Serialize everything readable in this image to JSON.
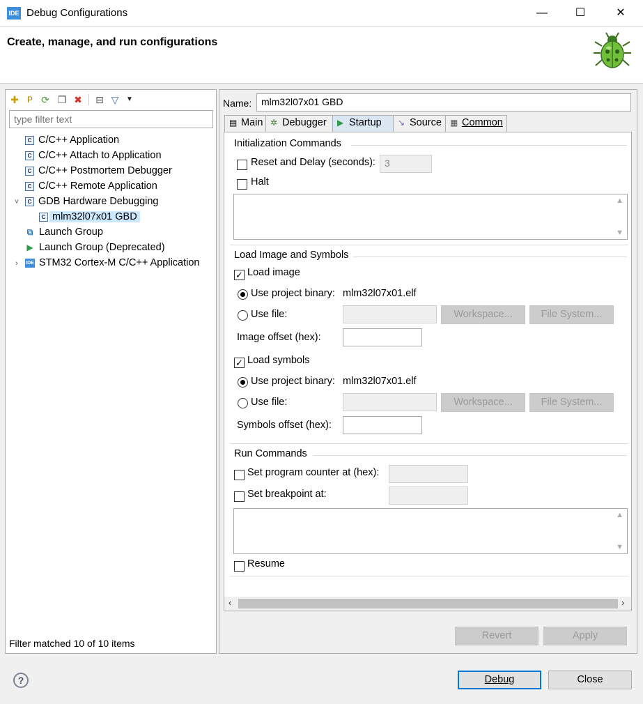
{
  "window": {
    "title": "Debug Configurations",
    "app_icon_text": "IDE",
    "minimize_glyph": "—",
    "maximize_glyph": "☐",
    "close_glyph": "✕"
  },
  "header": {
    "title": "Create, manage, and run configurations"
  },
  "left": {
    "filter_placeholder": "type filter text",
    "toolbar_icons": [
      "new-configuration-icon",
      "new-prototype-icon",
      "export-icon",
      "duplicate-icon",
      "delete-icon",
      "collapse-all-icon",
      "filter-icon",
      "chevron-down-icon"
    ],
    "tree": [
      {
        "label": "C/C++ Application",
        "icon": "c-config-icon",
        "level": 0,
        "twisty": ""
      },
      {
        "label": "C/C++ Attach to Application",
        "icon": "c-config-icon",
        "level": 0,
        "twisty": ""
      },
      {
        "label": "C/C++ Postmortem Debugger",
        "icon": "c-config-icon",
        "level": 0,
        "twisty": ""
      },
      {
        "label": "C/C++ Remote Application",
        "icon": "c-config-icon",
        "level": 0,
        "twisty": ""
      },
      {
        "label": "GDB Hardware Debugging",
        "icon": "c-config-icon",
        "level": 0,
        "twisty": "˅"
      },
      {
        "label": "mlm32l07x01 GBD",
        "icon": "c-config-icon",
        "level": 1,
        "twisty": "",
        "selected": true
      },
      {
        "label": "Launch Group",
        "icon": "launch-group-icon",
        "level": 0,
        "twisty": ""
      },
      {
        "label": "Launch Group (Deprecated)",
        "icon": "launch-deprecated-icon",
        "level": 0,
        "twisty": ""
      },
      {
        "label": "STM32 Cortex-M C/C++ Application",
        "icon": "ide-icon",
        "level": 0,
        "twisty": "›"
      }
    ],
    "status": "Filter matched 10 of 10 items"
  },
  "right": {
    "name_label": "Name:",
    "name_value": "mlm32l07x01 GBD",
    "tabs": [
      {
        "label": "Main",
        "icon": "main-tab-icon",
        "glyph": "▤"
      },
      {
        "label": "Debugger",
        "icon": "debugger-tab-icon",
        "glyph": "✲"
      },
      {
        "label": "Startup",
        "icon": "startup-tab-icon",
        "glyph": "▶"
      },
      {
        "label": "Source",
        "icon": "source-tab-icon",
        "glyph": "↘"
      },
      {
        "label": "Common",
        "icon": "common-tab-icon",
        "glyph": "▦"
      }
    ],
    "active_tab": "Startup",
    "init": {
      "title": "Initialization Commands",
      "reset_label": "Reset and Delay (seconds):",
      "reset_checked": false,
      "delay_value": "3",
      "halt_label": "Halt",
      "halt_checked": false
    },
    "load": {
      "title": "Load Image and Symbols",
      "load_image_label": "Load image",
      "load_image_checked": true,
      "use_project_binary_label": "Use project binary:",
      "image_binary": "mlm32l07x01.elf",
      "use_file_label": "Use file:",
      "workspace_label": "Workspace...",
      "filesystem_label": "File System...",
      "image_offset_label": "Image offset (hex):",
      "image_offset_value": "",
      "load_symbols_label": "Load symbols",
      "load_symbols_checked": true,
      "symbols_binary": "mlm32l07x01.elf",
      "symbols_offset_label": "Symbols offset (hex):",
      "symbols_offset_value": ""
    },
    "run": {
      "title": "Run Commands",
      "pc_label": "Set program counter at (hex):",
      "pc_checked": false,
      "breakpoint_label": "Set breakpoint at:",
      "breakpoint_checked": false,
      "resume_label": "Resume",
      "resume_checked": false
    },
    "revert_label": "Revert",
    "apply_label": "Apply"
  },
  "footer": {
    "help_glyph": "?",
    "debug_label": "Debug",
    "close_label": "Close"
  },
  "colors": {
    "accent": "#0078d7",
    "selection": "#cce8ff",
    "delete": "#d32f2f",
    "bug_green": "#4caf50"
  }
}
